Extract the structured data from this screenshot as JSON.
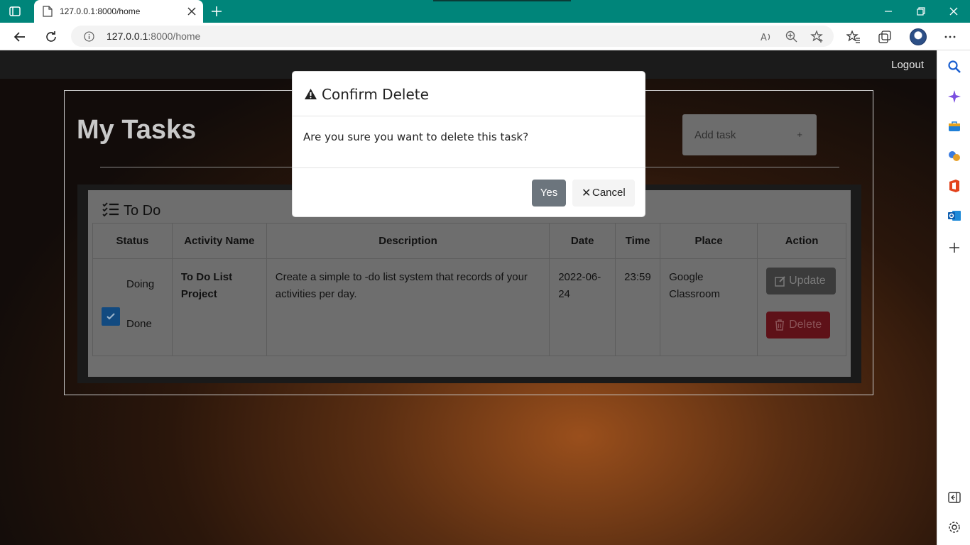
{
  "browser": {
    "tab_title": "127.0.0.1:8000/home",
    "url_host": "127.0.0.1",
    "url_rest": ":8000/home"
  },
  "page": {
    "logout_label": "Logout",
    "heading": "My Tasks",
    "add_task_placeholder": "Add task",
    "add_task_plus": "+",
    "card_title": "To Do",
    "table": {
      "headers": [
        "Status",
        "Activity Name",
        "Description",
        "Date",
        "Time",
        "Place",
        "Action"
      ],
      "row": {
        "status_doing": "Doing",
        "status_done": "Done",
        "activity_name": "To Do List Project",
        "description": "Create a simple to -do list system that records of your activities per day.",
        "date": "2022-06-24",
        "time": "23:59",
        "place": "Google Classroom",
        "update_label": "Update",
        "delete_label": "Delete"
      }
    }
  },
  "modal": {
    "title": "Confirm Delete",
    "message": "Are you sure you want to delete this task?",
    "yes_label": "Yes",
    "cancel_label": "Cancel"
  },
  "colors": {
    "chrome_accent": "#00857a",
    "modal_yes": "#6c757d",
    "done_checkbox": "#124a80"
  }
}
